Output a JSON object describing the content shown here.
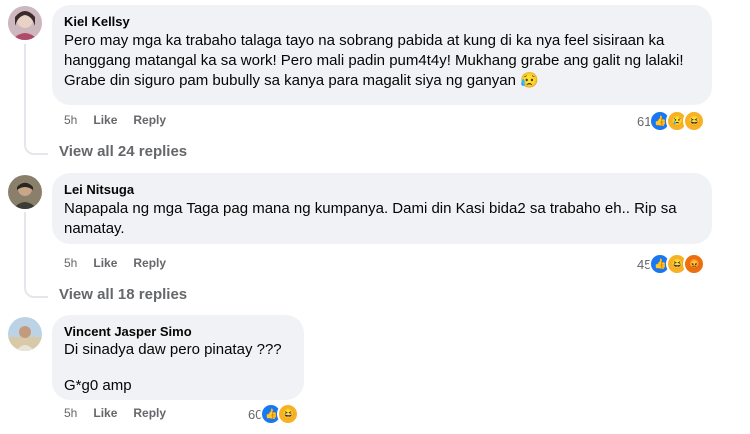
{
  "comments": [
    {
      "author": "Kiel Kellsy",
      "text": "Pero may mga ka trabaho talaga tayo na sobrang pabida at kung di ka nya feel sisiraan ka hanggang matangal ka sa work! Pero mali padin pum4t4y! Mukhang grabe ang galit ng lalaki! Grabe din siguro pam bubully sa kanya para magalit siya ng ganyan 😥",
      "time": "5h",
      "like_label": "Like",
      "reply_label": "Reply",
      "reaction_count": "61",
      "reactions": [
        "like-icon",
        "sad-icon",
        "haha-icon"
      ],
      "view_replies": "View all 24 replies"
    },
    {
      "author": "Lei Nitsuga",
      "text": "Napapala ng mga Taga pag mana ng kumpanya. Dami din Kasi bida2 sa trabaho eh.. Rip sa namatay.",
      "time": "5h",
      "like_label": "Like",
      "reply_label": "Reply",
      "reaction_count": "45",
      "reactions": [
        "like-icon",
        "haha-icon",
        "angry-icon"
      ],
      "view_replies": "View all 18 replies"
    },
    {
      "author": "Vincent Jasper Simo",
      "text": "Di sinadya daw pero pinatay ???\n\nG*g0 amp",
      "time": "5h",
      "like_label": "Like",
      "reply_label": "Reply",
      "reaction_count": "60",
      "reactions": [
        "like-icon",
        "haha-icon"
      ]
    }
  ],
  "colors": {
    "bubble": "#f0f2f5",
    "meta": "#65676b",
    "like_blue": "#1877f2"
  }
}
